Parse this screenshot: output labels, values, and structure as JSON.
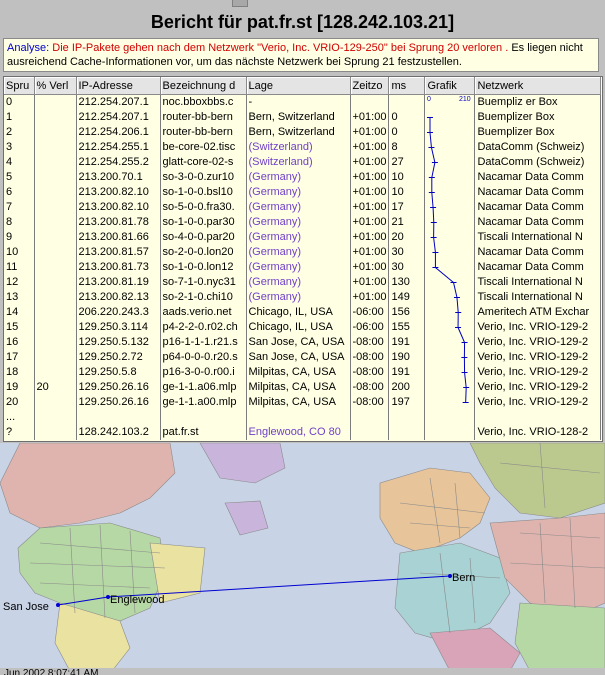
{
  "header": {
    "title": "Bericht für pat.fr.st [128.242.103.21]"
  },
  "analysis": {
    "label": "Analyse:",
    "red_text": "Die IP-Pakete gehen nach dem Netzwerk \"Verio, Inc. VRIO-129-250\"  bei Sprung 20 verloren .",
    "black_text": " Es liegen nicht ausreichend Cache-Informationen vor, um das nächste Netzwerk bei Sprung 21 festzustellen."
  },
  "table": {
    "columns": [
      "Spru",
      "% Verl",
      "IP-Adresse",
      "Bezeichnung d",
      "Lage",
      "Zeitzo",
      "ms",
      "Grafik",
      "Netzwerk"
    ],
    "graph_scale_min": "0",
    "graph_scale_max": "210",
    "rows": [
      {
        "hop": "0",
        "loss": "",
        "ip": "212.254.207.1",
        "name": "noc.bboxbbs.c",
        "location": "-",
        "loc_guess": false,
        "tz": "",
        "ms": "",
        "ms_value": 0,
        "network": "Buempliz er Box"
      },
      {
        "hop": "1",
        "loss": "",
        "ip": "212.254.207.1",
        "name": "router-bb-bern",
        "location": "Bern, Switzerland",
        "loc_guess": false,
        "tz": "+01:00",
        "ms": "0",
        "ms_value": 0,
        "network": "Buemplizer Box"
      },
      {
        "hop": "2",
        "loss": "",
        "ip": "212.254.206.1",
        "name": "router-bb-bern",
        "location": "Bern, Switzerland",
        "loc_guess": false,
        "tz": "+01:00",
        "ms": "0",
        "ms_value": 0,
        "network": "Buemplizer Box"
      },
      {
        "hop": "3",
        "loss": "",
        "ip": "212.254.255.1",
        "name": "be-core-02.tisc",
        "location": "(Switzerland)",
        "loc_guess": true,
        "tz": "+01:00",
        "ms": "8",
        "ms_value": 8,
        "network": "DataComm (Schweiz)"
      },
      {
        "hop": "4",
        "loss": "",
        "ip": "212.254.255.2",
        "name": "glatt-core-02-s",
        "location": "(Switzerland)",
        "loc_guess": true,
        "tz": "+01:00",
        "ms": "27",
        "ms_value": 27,
        "network": "DataComm (Schweiz)"
      },
      {
        "hop": "5",
        "loss": "",
        "ip": "213.200.70.1",
        "name": "so-3-0-0.zur10",
        "location": "(Germany)",
        "loc_guess": true,
        "tz": "+01:00",
        "ms": "10",
        "ms_value": 10,
        "network": "Nacamar Data Comm"
      },
      {
        "hop": "6",
        "loss": "",
        "ip": "213.200.82.10",
        "name": "so-1-0-0.bsl10",
        "location": "(Germany)",
        "loc_guess": true,
        "tz": "+01:00",
        "ms": "10",
        "ms_value": 10,
        "network": "Nacamar Data Comm"
      },
      {
        "hop": "7",
        "loss": "",
        "ip": "213.200.82.10",
        "name": "so-5-0-0.fra30.",
        "location": "(Germany)",
        "loc_guess": true,
        "tz": "+01:00",
        "ms": "17",
        "ms_value": 17,
        "network": "Nacamar Data Comm"
      },
      {
        "hop": "8",
        "loss": "",
        "ip": "213.200.81.78",
        "name": "so-1-0-0.par30",
        "location": "(Germany)",
        "loc_guess": true,
        "tz": "+01:00",
        "ms": "21",
        "ms_value": 21,
        "network": "Nacamar Data Comm"
      },
      {
        "hop": "9",
        "loss": "",
        "ip": "213.200.81.66",
        "name": "so-4-0-0.par20",
        "location": "(Germany)",
        "loc_guess": true,
        "tz": "+01:00",
        "ms": "20",
        "ms_value": 20,
        "network": "Tiscali International N"
      },
      {
        "hop": "10",
        "loss": "",
        "ip": "213.200.81.57",
        "name": "so-2-0-0.lon20",
        "location": "(Germany)",
        "loc_guess": true,
        "tz": "+01:00",
        "ms": "30",
        "ms_value": 30,
        "network": "Nacamar Data Comm"
      },
      {
        "hop": "11",
        "loss": "",
        "ip": "213.200.81.73",
        "name": "so-1-0-0.lon12",
        "location": "(Germany)",
        "loc_guess": true,
        "tz": "+01:00",
        "ms": "30",
        "ms_value": 30,
        "network": "Nacamar Data Comm"
      },
      {
        "hop": "12",
        "loss": "",
        "ip": "213.200.81.19",
        "name": "so-7-1-0.nyc31",
        "location": "(Germany)",
        "loc_guess": true,
        "tz": "+01:00",
        "ms": "130",
        "ms_value": 130,
        "network": "Tiscali International N"
      },
      {
        "hop": "13",
        "loss": "",
        "ip": "213.200.82.13",
        "name": "so-2-1-0.chi10",
        "location": "(Germany)",
        "loc_guess": true,
        "tz": "+01:00",
        "ms": "149",
        "ms_value": 149,
        "network": "Tiscali International N"
      },
      {
        "hop": "14",
        "loss": "",
        "ip": "206.220.243.3",
        "name": "aads.verio.net",
        "location": "Chicago, IL, USA",
        "loc_guess": false,
        "tz": "-06:00",
        "ms": "156",
        "ms_value": 156,
        "network": "Ameritech ATM Exchar"
      },
      {
        "hop": "15",
        "loss": "",
        "ip": "129.250.3.114",
        "name": "p4-2-2-0.r02.ch",
        "location": "Chicago, IL, USA",
        "loc_guess": false,
        "tz": "-06:00",
        "ms": "155",
        "ms_value": 155,
        "network": "Verio, Inc. VRIO-129-2"
      },
      {
        "hop": "16",
        "loss": "",
        "ip": "129.250.5.132",
        "name": "p16-1-1-1.r21.s",
        "location": "San Jose, CA, USA",
        "loc_guess": false,
        "tz": "-08:00",
        "ms": "191",
        "ms_value": 191,
        "network": "Verio, Inc. VRIO-129-2"
      },
      {
        "hop": "17",
        "loss": "",
        "ip": "129.250.2.72",
        "name": "p64-0-0-0.r20.s",
        "location": "San Jose, CA, USA",
        "loc_guess": false,
        "tz": "-08:00",
        "ms": "190",
        "ms_value": 190,
        "network": "Verio, Inc. VRIO-129-2"
      },
      {
        "hop": "18",
        "loss": "",
        "ip": "129.250.5.8",
        "name": "p16-3-0-0.r00.i",
        "location": "Milpitas, CA, USA",
        "loc_guess": false,
        "tz": "-08:00",
        "ms": "191",
        "ms_value": 191,
        "network": "Verio, Inc. VRIO-129-2"
      },
      {
        "hop": "19",
        "loss": "20",
        "ip": "129.250.26.16",
        "name": "ge-1-1.a06.mlp",
        "location": "Milpitas, CA, USA",
        "loc_guess": false,
        "tz": "-08:00",
        "ms": "200",
        "ms_value": 200,
        "network": "Verio, Inc. VRIO-129-2"
      },
      {
        "hop": "20",
        "loss": "",
        "ip": "129.250.26.16",
        "name": "ge-1-1.a00.mlp",
        "location": "Milpitas, CA, USA",
        "loc_guess": false,
        "tz": "-08:00",
        "ms": "197",
        "ms_value": 197,
        "network": "Verio, Inc. VRIO-129-2"
      },
      {
        "hop": "...",
        "loss": "",
        "ip": "",
        "name": "",
        "location": "",
        "loc_guess": false,
        "tz": "",
        "ms": "",
        "ms_value": null,
        "network": ""
      },
      {
        "hop": "?",
        "loss": "",
        "ip": "128.242.103.2",
        "name": "pat.fr.st",
        "location": "Englewood, CO 80",
        "loc_guess": true,
        "tz": "",
        "ms": "",
        "ms_value": null,
        "network": "Verio, Inc. VRIO-128-2"
      }
    ]
  },
  "map": {
    "labels": {
      "bern": "Bern",
      "englewood": "Englewood",
      "sanjose": "San Jose"
    },
    "colors": {
      "ocean": "#c8d3e6",
      "route": "#0000d0",
      "land": [
        "#e0b4ae",
        "#b6d8a4",
        "#e9e2a0",
        "#c9b4dc",
        "#e7c49a",
        "#a9d2d4",
        "#d9a4b8",
        "#bcc98e"
      ]
    }
  },
  "status": {
    "text": "Jun 2002   8:07:41 AM"
  }
}
